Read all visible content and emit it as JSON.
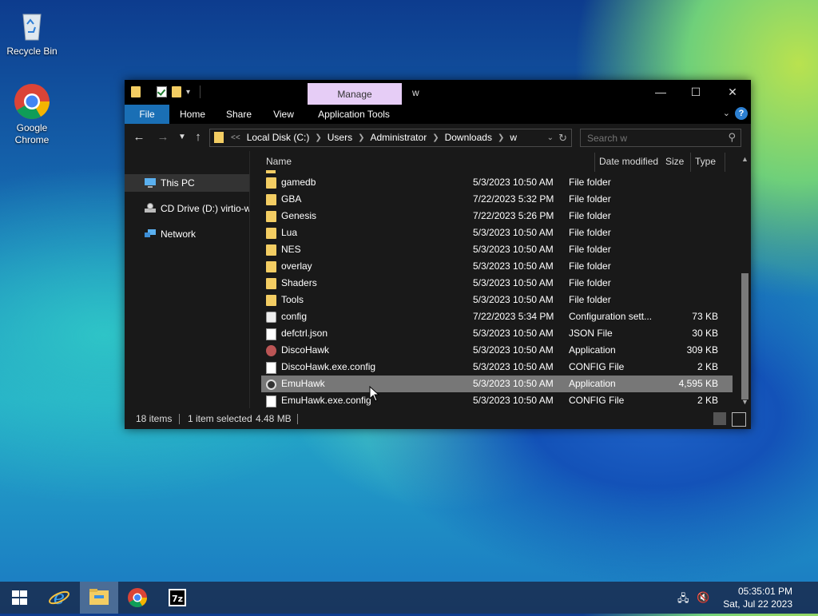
{
  "desktop": {
    "icons": [
      {
        "label": "Recycle Bin",
        "icon": "recycle-bin-icon"
      },
      {
        "label": "Google Chrome",
        "icon": "chrome-icon"
      }
    ]
  },
  "window": {
    "manage_tab": "Manage",
    "title": "w",
    "ribbon_tabs": [
      "File",
      "Home",
      "Share",
      "View",
      "Application Tools"
    ],
    "help_label": "?",
    "address": {
      "overflow": "<<",
      "crumbs": [
        "Local Disk (C:)",
        "Users",
        "Administrator",
        "Downloads",
        "w"
      ]
    },
    "search_placeholder": "Search w",
    "nav_pane": [
      {
        "label": "This PC",
        "icon": "this-pc-icon",
        "selected": true
      },
      {
        "label": "CD Drive (D:) virtio-w",
        "icon": "cd-drive-icon",
        "selected": false
      },
      {
        "label": "Network",
        "icon": "network-icon",
        "selected": false
      }
    ],
    "columns": [
      "Name",
      "Date modified",
      "Type",
      "Size"
    ],
    "files": [
      {
        "name": "gamedb",
        "date": "5/3/2023 10:50 AM",
        "type": "File folder",
        "size": "",
        "icon": "folder-icon"
      },
      {
        "name": "GBA",
        "date": "7/22/2023 5:32 PM",
        "type": "File folder",
        "size": "",
        "icon": "folder-icon"
      },
      {
        "name": "Genesis",
        "date": "7/22/2023 5:26 PM",
        "type": "File folder",
        "size": "",
        "icon": "folder-icon"
      },
      {
        "name": "Lua",
        "date": "5/3/2023 10:50 AM",
        "type": "File folder",
        "size": "",
        "icon": "folder-icon"
      },
      {
        "name": "NES",
        "date": "5/3/2023 10:50 AM",
        "type": "File folder",
        "size": "",
        "icon": "folder-icon"
      },
      {
        "name": "overlay",
        "date": "5/3/2023 10:50 AM",
        "type": "File folder",
        "size": "",
        "icon": "folder-icon"
      },
      {
        "name": "Shaders",
        "date": "5/3/2023 10:50 AM",
        "type": "File folder",
        "size": "",
        "icon": "folder-icon"
      },
      {
        "name": "Tools",
        "date": "5/3/2023 10:50 AM",
        "type": "File folder",
        "size": "",
        "icon": "folder-icon"
      },
      {
        "name": "config",
        "date": "7/22/2023 5:34 PM",
        "type": "Configuration sett...",
        "size": "73 KB",
        "icon": "config-file-icon"
      },
      {
        "name": "defctrl.json",
        "date": "5/3/2023 10:50 AM",
        "type": "JSON File",
        "size": "30 KB",
        "icon": "file-icon"
      },
      {
        "name": "DiscoHawk",
        "date": "5/3/2023 10:50 AM",
        "type": "Application",
        "size": "309 KB",
        "icon": "discohawk-app-icon"
      },
      {
        "name": "DiscoHawk.exe.config",
        "date": "5/3/2023 10:50 AM",
        "type": "CONFIG File",
        "size": "2 KB",
        "icon": "file-icon"
      },
      {
        "name": "EmuHawk",
        "date": "5/3/2023 10:50 AM",
        "type": "Application",
        "size": "4,595 KB",
        "icon": "emuhawk-app-icon",
        "selected": true
      },
      {
        "name": "EmuHawk.exe.config",
        "date": "5/3/2023 10:50 AM",
        "type": "CONFIG File",
        "size": "2 KB",
        "icon": "file-icon"
      }
    ],
    "status": {
      "items": "18 items",
      "selected": "1 item selected",
      "size": "4.48 MB"
    }
  },
  "taskbar": {
    "apps": [
      "start-icon",
      "internet-explorer-icon",
      "file-explorer-icon",
      "chrome-icon",
      "7zip-icon"
    ],
    "time": "05:35:01 PM",
    "date": "Sat, Jul 22 2023"
  },
  "colors": {
    "selection_row": "#777777",
    "file_tab": "#1a6fb5",
    "manage_tab": "#e6cdf6",
    "folder": "#f3cd63"
  }
}
